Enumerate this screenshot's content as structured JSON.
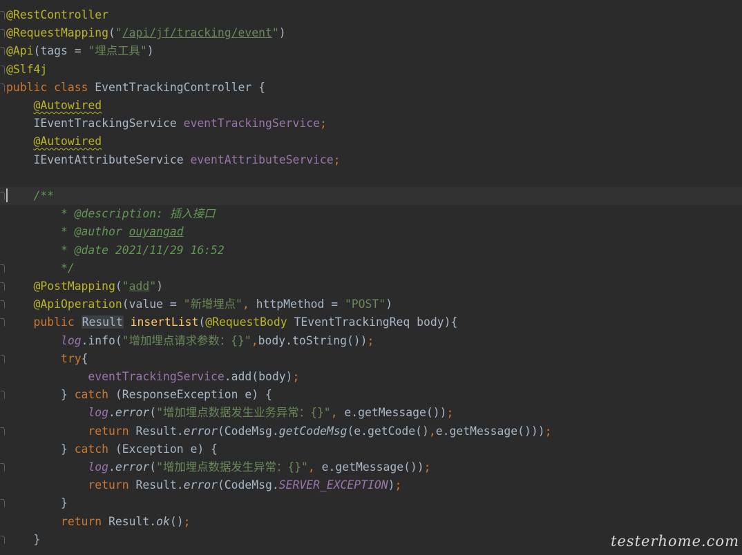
{
  "editor": {
    "lines": [
      "@RestController",
      "@RequestMapping(\"/api/jf/tracking/event\")",
      "@Api(tags = \"埋点工具\")",
      "@Slf4j",
      "public class EventTrackingController {",
      "    @Autowired",
      "    IEventTrackingService eventTrackingService;",
      "    @Autowired",
      "    IEventAttributeService eventAttributeService;",
      "",
      "    /**",
      "        * @description: 插入接口",
      "        * @author ouyangad",
      "        * @date 2021/11/29 16:52",
      "        */",
      "    @PostMapping(\"add\")",
      "    @ApiOperation(value = \"新增埋点\", httpMethod = \"POST\")",
      "    public Result insertList(@RequestBody TEventTrackingReq body){",
      "        log.info(\"增加埋点请求参数：{}\",body.toString());",
      "        try{",
      "            eventTrackingService.add(body);",
      "        } catch (ResponseException e) {",
      "            log.error(\"增加埋点数据发生业务异常：{}\", e.getMessage());",
      "            return Result.error(CodeMsg.getCodeMsg(e.getCode(),e.getMessage()));",
      "        } catch (Exception e) {",
      "            log.error(\"增加埋点数据发生异常：{}\", e.getMessage());",
      "            return Result.error(CodeMsg.SERVER_EXCEPTION);",
      "        }",
      "        return Result.ok();",
      "    }"
    ]
  },
  "watermark": "testerhome.com",
  "colors": {
    "background": "#2b2b2b",
    "current_line": "#323232",
    "annotation": "#bbb529",
    "keyword": "#cc7832",
    "string": "#6a8759",
    "field": "#9876aa",
    "method": "#ffc66d",
    "doc_comment": "#629755",
    "text": "#a9b7c6"
  }
}
